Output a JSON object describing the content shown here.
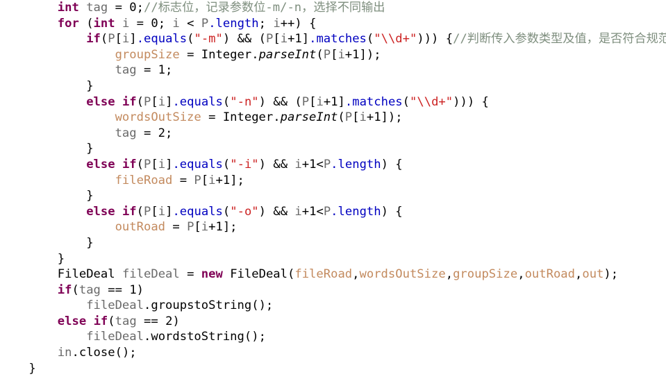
{
  "editor": {
    "language": "java",
    "background": "#ffffff",
    "font_size_px": 17,
    "line_height_px": 22.6
  },
  "theme": {
    "keyword": "#7f0055",
    "local_variable": "#6a6a6a",
    "field": "#c38a5e",
    "string": "#cc2222",
    "comment": "#7f8f7f",
    "member_blue": "#0000c0",
    "plain": "#000000"
  },
  "lines": [
    {
      "n": 1,
      "indent": "        ",
      "tokens": [
        {
          "t": "int",
          "c": "kw"
        },
        {
          "t": " ",
          "c": "pln"
        },
        {
          "t": "tag",
          "c": "var"
        },
        {
          "t": " = ",
          "c": "pln"
        },
        {
          "t": "0",
          "c": "num"
        },
        {
          "t": ";",
          "c": "pln"
        },
        {
          "t": "//标志位，记录参数位-m/-n，选择不同输出",
          "c": "cmt"
        }
      ]
    },
    {
      "n": 2,
      "indent": "        ",
      "tokens": [
        {
          "t": "for",
          "c": "kw"
        },
        {
          "t": " (",
          "c": "pln"
        },
        {
          "t": "int",
          "c": "kw"
        },
        {
          "t": " ",
          "c": "pln"
        },
        {
          "t": "i",
          "c": "var"
        },
        {
          "t": " = ",
          "c": "pln"
        },
        {
          "t": "0",
          "c": "num"
        },
        {
          "t": "; ",
          "c": "pln"
        },
        {
          "t": "i",
          "c": "var"
        },
        {
          "t": " < ",
          "c": "pln"
        },
        {
          "t": "P",
          "c": "var"
        },
        {
          "t": ".length",
          "c": "blu"
        },
        {
          "t": "; ",
          "c": "pln"
        },
        {
          "t": "i",
          "c": "var"
        },
        {
          "t": "++) {",
          "c": "pln"
        }
      ]
    },
    {
      "n": 3,
      "indent": "            ",
      "tokens": [
        {
          "t": "if",
          "c": "kw"
        },
        {
          "t": "(",
          "c": "pln"
        },
        {
          "t": "P",
          "c": "var"
        },
        {
          "t": "[",
          "c": "pln"
        },
        {
          "t": "i",
          "c": "var"
        },
        {
          "t": "]",
          "c": "pln"
        },
        {
          "t": ".equals",
          "c": "blu"
        },
        {
          "t": "(",
          "c": "pln"
        },
        {
          "t": "\"-m\"",
          "c": "str"
        },
        {
          "t": ") && (",
          "c": "pln"
        },
        {
          "t": "P",
          "c": "var"
        },
        {
          "t": "[",
          "c": "pln"
        },
        {
          "t": "i",
          "c": "var"
        },
        {
          "t": "+1]",
          "c": "pln"
        },
        {
          "t": ".matches",
          "c": "blu"
        },
        {
          "t": "(",
          "c": "pln"
        },
        {
          "t": "\"\\\\d+\"",
          "c": "str"
        },
        {
          "t": "))) {",
          "c": "pln"
        },
        {
          "t": "//判断传入参数类型及值，是否符合规范",
          "c": "cmt"
        }
      ]
    },
    {
      "n": 4,
      "indent": "                ",
      "tokens": [
        {
          "t": "groupSize",
          "c": "fld"
        },
        {
          "t": " = ",
          "c": "pln"
        },
        {
          "t": "Integer",
          "c": "typ"
        },
        {
          "t": ".",
          "c": "pln"
        },
        {
          "t": "parseInt",
          "c": "mthi"
        },
        {
          "t": "(",
          "c": "pln"
        },
        {
          "t": "P",
          "c": "var"
        },
        {
          "t": "[",
          "c": "pln"
        },
        {
          "t": "i",
          "c": "var"
        },
        {
          "t": "+1]);",
          "c": "pln"
        }
      ]
    },
    {
      "n": 5,
      "indent": "                ",
      "tokens": [
        {
          "t": "tag",
          "c": "var"
        },
        {
          "t": " = ",
          "c": "pln"
        },
        {
          "t": "1",
          "c": "num"
        },
        {
          "t": ";",
          "c": "pln"
        }
      ]
    },
    {
      "n": 6,
      "indent": "            ",
      "tokens": [
        {
          "t": "}",
          "c": "pln"
        }
      ]
    },
    {
      "n": 7,
      "indent": "            ",
      "tokens": [
        {
          "t": "else",
          "c": "kw"
        },
        {
          "t": " ",
          "c": "pln"
        },
        {
          "t": "if",
          "c": "kw"
        },
        {
          "t": "(",
          "c": "pln"
        },
        {
          "t": "P",
          "c": "var"
        },
        {
          "t": "[",
          "c": "pln"
        },
        {
          "t": "i",
          "c": "var"
        },
        {
          "t": "]",
          "c": "pln"
        },
        {
          "t": ".equals",
          "c": "blu"
        },
        {
          "t": "(",
          "c": "pln"
        },
        {
          "t": "\"-n\"",
          "c": "str"
        },
        {
          "t": ") && (",
          "c": "pln"
        },
        {
          "t": "P",
          "c": "var"
        },
        {
          "t": "[",
          "c": "pln"
        },
        {
          "t": "i",
          "c": "var"
        },
        {
          "t": "+1]",
          "c": "pln"
        },
        {
          "t": ".matches",
          "c": "blu"
        },
        {
          "t": "(",
          "c": "pln"
        },
        {
          "t": "\"\\\\d+\"",
          "c": "str"
        },
        {
          "t": "))) {",
          "c": "pln"
        }
      ]
    },
    {
      "n": 8,
      "indent": "                ",
      "tokens": [
        {
          "t": "wordsOutSize",
          "c": "fld"
        },
        {
          "t": " = ",
          "c": "pln"
        },
        {
          "t": "Integer",
          "c": "typ"
        },
        {
          "t": ".",
          "c": "pln"
        },
        {
          "t": "parseInt",
          "c": "mthi"
        },
        {
          "t": "(",
          "c": "pln"
        },
        {
          "t": "P",
          "c": "var"
        },
        {
          "t": "[",
          "c": "pln"
        },
        {
          "t": "i",
          "c": "var"
        },
        {
          "t": "+1]);",
          "c": "pln"
        }
      ]
    },
    {
      "n": 9,
      "indent": "                ",
      "tokens": [
        {
          "t": "tag",
          "c": "var"
        },
        {
          "t": " = ",
          "c": "pln"
        },
        {
          "t": "2",
          "c": "num"
        },
        {
          "t": ";",
          "c": "pln"
        }
      ]
    },
    {
      "n": 10,
      "indent": "            ",
      "tokens": [
        {
          "t": "}",
          "c": "pln"
        }
      ]
    },
    {
      "n": 11,
      "indent": "            ",
      "tokens": [
        {
          "t": "else",
          "c": "kw"
        },
        {
          "t": " ",
          "c": "pln"
        },
        {
          "t": "if",
          "c": "kw"
        },
        {
          "t": "(",
          "c": "pln"
        },
        {
          "t": "P",
          "c": "var"
        },
        {
          "t": "[",
          "c": "pln"
        },
        {
          "t": "i",
          "c": "var"
        },
        {
          "t": "]",
          "c": "pln"
        },
        {
          "t": ".equals",
          "c": "blu"
        },
        {
          "t": "(",
          "c": "pln"
        },
        {
          "t": "\"-i\"",
          "c": "str"
        },
        {
          "t": ") && ",
          "c": "pln"
        },
        {
          "t": "i",
          "c": "var"
        },
        {
          "t": "+1<",
          "c": "pln"
        },
        {
          "t": "P",
          "c": "var"
        },
        {
          "t": ".length",
          "c": "blu"
        },
        {
          "t": ") {",
          "c": "pln"
        }
      ]
    },
    {
      "n": 12,
      "indent": "                ",
      "tokens": [
        {
          "t": "fileRoad",
          "c": "fld"
        },
        {
          "t": " = ",
          "c": "pln"
        },
        {
          "t": "P",
          "c": "var"
        },
        {
          "t": "[",
          "c": "pln"
        },
        {
          "t": "i",
          "c": "var"
        },
        {
          "t": "+1];",
          "c": "pln"
        }
      ]
    },
    {
      "n": 13,
      "indent": "            ",
      "tokens": [
        {
          "t": "}",
          "c": "pln"
        }
      ]
    },
    {
      "n": 14,
      "indent": "            ",
      "tokens": [
        {
          "t": "else",
          "c": "kw"
        },
        {
          "t": " ",
          "c": "pln"
        },
        {
          "t": "if",
          "c": "kw"
        },
        {
          "t": "(",
          "c": "pln"
        },
        {
          "t": "P",
          "c": "var"
        },
        {
          "t": "[",
          "c": "pln"
        },
        {
          "t": "i",
          "c": "var"
        },
        {
          "t": "]",
          "c": "pln"
        },
        {
          "t": ".equals",
          "c": "blu"
        },
        {
          "t": "(",
          "c": "pln"
        },
        {
          "t": "\"-o\"",
          "c": "str"
        },
        {
          "t": ") && ",
          "c": "pln"
        },
        {
          "t": "i",
          "c": "var"
        },
        {
          "t": "+1<",
          "c": "pln"
        },
        {
          "t": "P",
          "c": "var"
        },
        {
          "t": ".length",
          "c": "blu"
        },
        {
          "t": ") {",
          "c": "pln"
        }
      ]
    },
    {
      "n": 15,
      "indent": "                ",
      "tokens": [
        {
          "t": "outRoad",
          "c": "fld"
        },
        {
          "t": " = ",
          "c": "pln"
        },
        {
          "t": "P",
          "c": "var"
        },
        {
          "t": "[",
          "c": "pln"
        },
        {
          "t": "i",
          "c": "var"
        },
        {
          "t": "+1];",
          "c": "pln"
        }
      ]
    },
    {
      "n": 16,
      "indent": "            ",
      "tokens": [
        {
          "t": "}",
          "c": "pln"
        }
      ]
    },
    {
      "n": 17,
      "indent": "        ",
      "tokens": [
        {
          "t": "}",
          "c": "pln"
        }
      ]
    },
    {
      "n": 18,
      "indent": "        ",
      "tokens": [
        {
          "t": "FileDeal",
          "c": "typ"
        },
        {
          "t": " ",
          "c": "pln"
        },
        {
          "t": "fileDeal",
          "c": "var"
        },
        {
          "t": " = ",
          "c": "pln"
        },
        {
          "t": "new",
          "c": "kw"
        },
        {
          "t": " ",
          "c": "pln"
        },
        {
          "t": "FileDeal",
          "c": "typ"
        },
        {
          "t": "(",
          "c": "pln"
        },
        {
          "t": "fileRoad",
          "c": "fld"
        },
        {
          "t": ",",
          "c": "pln"
        },
        {
          "t": "wordsOutSize",
          "c": "fld"
        },
        {
          "t": ",",
          "c": "pln"
        },
        {
          "t": "groupSize",
          "c": "fld"
        },
        {
          "t": ",",
          "c": "pln"
        },
        {
          "t": "outRoad",
          "c": "fld"
        },
        {
          "t": ",",
          "c": "pln"
        },
        {
          "t": "out",
          "c": "fld"
        },
        {
          "t": ");",
          "c": "pln"
        }
      ]
    },
    {
      "n": 19,
      "indent": "        ",
      "tokens": [
        {
          "t": "if",
          "c": "kw"
        },
        {
          "t": "(",
          "c": "pln"
        },
        {
          "t": "tag",
          "c": "var"
        },
        {
          "t": " == ",
          "c": "pln"
        },
        {
          "t": "1",
          "c": "num"
        },
        {
          "t": ")",
          "c": "pln"
        }
      ]
    },
    {
      "n": 20,
      "indent": "            ",
      "tokens": [
        {
          "t": "fileDeal",
          "c": "var"
        },
        {
          "t": ".",
          "c": "pln"
        },
        {
          "t": "groupstoString",
          "c": "mth"
        },
        {
          "t": "();",
          "c": "pln"
        }
      ]
    },
    {
      "n": 21,
      "indent": "        ",
      "tokens": [
        {
          "t": "else",
          "c": "kw"
        },
        {
          "t": " ",
          "c": "pln"
        },
        {
          "t": "if",
          "c": "kw"
        },
        {
          "t": "(",
          "c": "pln"
        },
        {
          "t": "tag",
          "c": "var"
        },
        {
          "t": " == ",
          "c": "pln"
        },
        {
          "t": "2",
          "c": "num"
        },
        {
          "t": ")",
          "c": "pln"
        }
      ]
    },
    {
      "n": 22,
      "indent": "            ",
      "tokens": [
        {
          "t": "fileDeal",
          "c": "var"
        },
        {
          "t": ".",
          "c": "pln"
        },
        {
          "t": "wordstoString",
          "c": "mth"
        },
        {
          "t": "();",
          "c": "pln"
        }
      ]
    },
    {
      "n": 23,
      "indent": "        ",
      "tokens": [
        {
          "t": "in",
          "c": "var"
        },
        {
          "t": ".",
          "c": "pln"
        },
        {
          "t": "close",
          "c": "mth"
        },
        {
          "t": "();",
          "c": "pln"
        }
      ]
    },
    {
      "n": 24,
      "indent": "    ",
      "tokens": [
        {
          "t": "}",
          "c": "pln"
        }
      ]
    }
  ]
}
